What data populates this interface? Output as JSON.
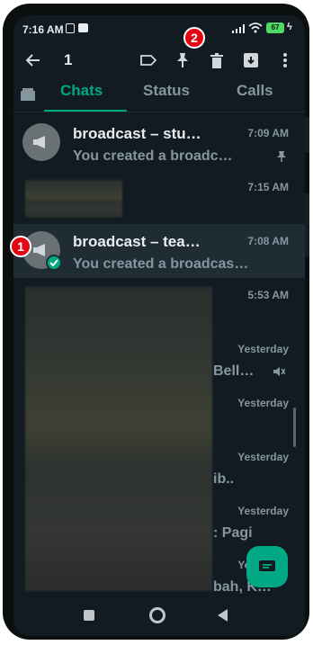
{
  "status_bar": {
    "time": "7:16 AM",
    "battery": "67"
  },
  "app_bar": {
    "selected_count": "1"
  },
  "tabs": [
    {
      "label": "Chats",
      "active": true
    },
    {
      "label": "Status",
      "active": false
    },
    {
      "label": "Calls",
      "active": false
    }
  ],
  "chats": [
    {
      "name": "broadcast – stu…",
      "preview": "You created a broadc…",
      "time": "7:09 AM",
      "pinned": true
    },
    {
      "name": "",
      "preview": "",
      "time": "7:15 AM"
    },
    {
      "name": "broadcast – tea…",
      "preview": "You created a broadcas…",
      "time": "7:08 AM",
      "selected": true
    },
    {
      "time": "5:53 AM"
    },
    {
      "time": "Yesterday",
      "fragment": "Bell…",
      "muted": true
    },
    {
      "time": "Yesterday"
    },
    {
      "time": "Yesterday",
      "fragment": "ib.."
    },
    {
      "time": "Yesterday",
      "fragment": ": Pagi"
    },
    {
      "time": "Yest",
      "fragment": "bah, K…"
    }
  ],
  "annotations": {
    "badge_1": "1",
    "badge_2": "2"
  },
  "colors": {
    "accent": "#00a884",
    "background": "#111b21",
    "selected_row": "#1f2c33",
    "badge": "#e30613"
  }
}
